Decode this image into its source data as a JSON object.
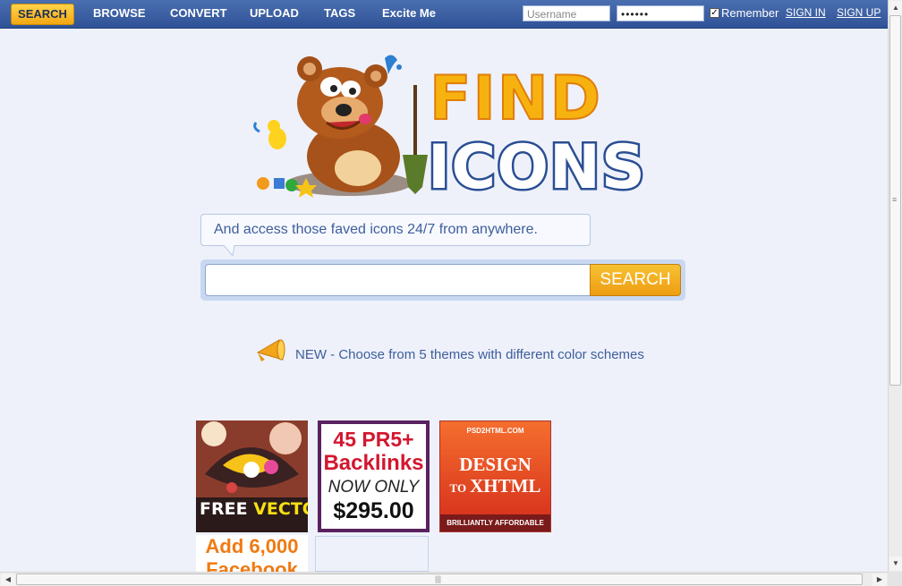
{
  "nav": {
    "search": "SEARCH",
    "browse": "BROWSE",
    "convert": "CONVERT",
    "upload": "UPLOAD",
    "tags": "TAGS",
    "excite": "Excite Me"
  },
  "login": {
    "username_placeholder": "Username",
    "password_value": "••••••",
    "remember_checked": true,
    "remember_label": "Remember",
    "sign_in": "SIGN IN",
    "sign_up": "SIGN UP"
  },
  "logo": {
    "line1": "FIND",
    "line2": "ICONS"
  },
  "bubble_text": "And access those faved icons 24/7 from anywhere.",
  "search": {
    "value": "",
    "button": "SEARCH"
  },
  "news": "NEW - Choose from 5 themes with different color schemes",
  "ads": {
    "ad1": "FREE VECTORS",
    "ad1_free": "FREE",
    "ad1_vectors": "VECTORS",
    "ad2_line1": "45 PR5+",
    "ad2_line2": "Backlinks",
    "ad2_line3": "NOW ONLY",
    "ad2_line4": "$295.00",
    "ad3_top": "PSD2HTML.COM",
    "ad3_line1": "DESIGN",
    "ad3_line2a": "TO",
    "ad3_line2b": "XHTML",
    "ad3_bottom": "BRILLIANTLY AFFORDABLE",
    "ad4_line1": "Add 6,000",
    "ad4_line2": "Facebook"
  },
  "colors": {
    "topbar": "#3a5ea2",
    "accent": "#f3a712",
    "link_text": "#3e5e9b",
    "page_bg": "#eef1fa"
  }
}
